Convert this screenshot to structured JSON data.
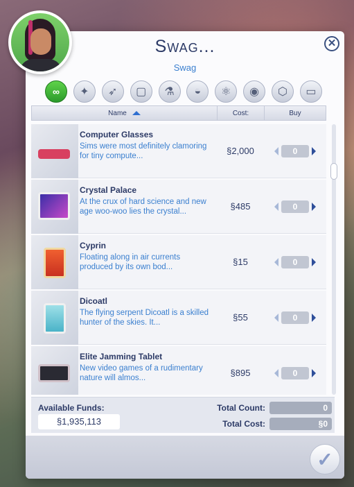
{
  "dialog": {
    "title": "Swag...",
    "subtitle": "Swag",
    "close_label": "✕",
    "confirm_label": "✓"
  },
  "categories": [
    {
      "name": "all",
      "label": "∞",
      "active": true
    },
    {
      "name": "mascot",
      "label": "✦"
    },
    {
      "name": "rocket",
      "label": "➶"
    },
    {
      "name": "frame",
      "label": "▢"
    },
    {
      "name": "microscope",
      "label": "⚗"
    },
    {
      "name": "glasses",
      "label": "◒"
    },
    {
      "name": "atom",
      "label": "⚛"
    },
    {
      "name": "plate",
      "label": "◉"
    },
    {
      "name": "box",
      "label": "⬡"
    },
    {
      "name": "can",
      "label": "▭"
    }
  ],
  "columns": {
    "name": "Name",
    "cost": "Cost:",
    "buy": "Buy"
  },
  "currency_symbol": "§",
  "items": [
    {
      "name": "Computer Glasses",
      "desc": "Sims were most definitely clamoring for tiny compute...",
      "cost": "§2,000",
      "qty": "0",
      "color": "#d84060"
    },
    {
      "name": "Crystal Palace",
      "desc": "At the crux of hard science and new age woo-woo lies the crystal...",
      "cost": "§485",
      "qty": "0",
      "color": "#5a3fc8"
    },
    {
      "name": "Cyprin",
      "desc": "Floating along in air currents produced by its own bod...",
      "cost": "§15",
      "qty": "0",
      "color": "#e0602a"
    },
    {
      "name": "Dicoatl",
      "desc": "The flying serpent Dicoatl is a skilled hunter of the skies. It...",
      "cost": "§55",
      "qty": "0",
      "color": "#4ab3c8"
    },
    {
      "name": "Elite Jamming Tablet",
      "desc": "New video games of a rudimentary nature will almos...",
      "cost": "§895",
      "qty": "0",
      "color": "#2a2a33"
    }
  ],
  "totals": {
    "funds_label": "Available Funds:",
    "funds_value": "§1,935,113",
    "count_label": "Total Count:",
    "count_value": "0",
    "cost_label": "Total Cost:",
    "cost_value": "§0"
  }
}
